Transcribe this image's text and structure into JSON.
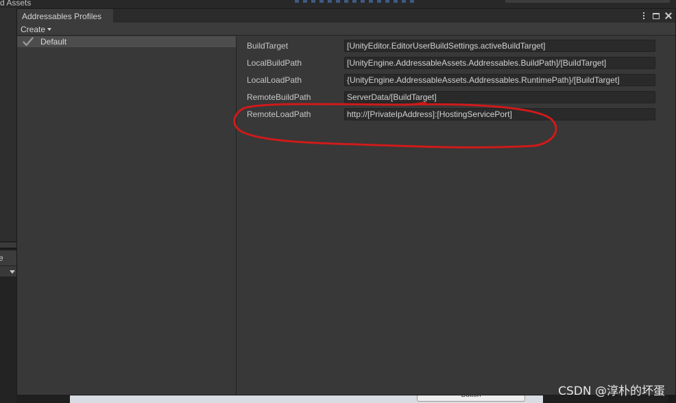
{
  "background": {
    "top_text": "d Assets",
    "left_tab_label": "e",
    "bottom_button_label": "Button"
  },
  "window": {
    "tab_title": "Addressables Profiles",
    "controls": [
      "more-icon",
      "maximize-icon",
      "close-icon"
    ]
  },
  "toolbar": {
    "create_label": "Create"
  },
  "profiles": {
    "items": [
      {
        "label": "Default",
        "selected": true,
        "icon": "check-icon"
      }
    ]
  },
  "variables": [
    {
      "name": "BuildTarget",
      "value": "[UnityEditor.EditorUserBuildSettings.activeBuildTarget]"
    },
    {
      "name": "LocalBuildPath",
      "value": "[UnityEngine.AddressableAssets.Addressables.BuildPath]/[BuildTarget]"
    },
    {
      "name": "LocalLoadPath",
      "value": "{UnityEngine.AddressableAssets.Addressables.RuntimePath}/[BuildTarget]"
    },
    {
      "name": "RemoteBuildPath",
      "value": "ServerData/[BuildTarget]"
    },
    {
      "name": "RemoteLoadPath",
      "value": "http://[PrivateIpAddress]:[HostingServicePort]"
    }
  ],
  "annotation": {
    "color": "#d01a1a",
    "highlights": "RemoteLoadPath"
  },
  "watermark": "CSDN @淳朴的坏蛋",
  "colors": {
    "window_bg": "#383838",
    "field_bg": "#2a2a2a",
    "selection_bg": "#4d4d4d"
  }
}
